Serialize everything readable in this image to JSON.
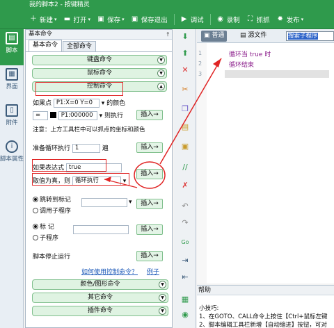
{
  "window": {
    "title": "我的脚本2 - 按键精灵"
  },
  "toolbar": {
    "items": [
      {
        "label": "新建",
        "icon": "new-icon"
      },
      {
        "label": "打开",
        "icon": "open-icon"
      },
      {
        "label": "保存",
        "icon": "save-icon"
      },
      {
        "label": "保存退出",
        "icon": "save-exit-icon"
      },
      {
        "label": "调试",
        "icon": "debug-icon"
      },
      {
        "label": "录制",
        "icon": "record-icon"
      },
      {
        "label": "抓抓",
        "icon": "capture-icon"
      },
      {
        "label": "发布",
        "icon": "publish-icon"
      }
    ]
  },
  "rail": {
    "items": [
      {
        "label": "脚本",
        "icon": "script-icon",
        "active": true
      },
      {
        "label": "界面",
        "icon": "ui-icon"
      },
      {
        "label": "附件",
        "icon": "attachment-icon"
      },
      {
        "label": "脚本属性",
        "icon": "info-icon"
      }
    ]
  },
  "panel": {
    "title": "基本命令",
    "pin": "⫯",
    "tabs": [
      "基本命令",
      "全部命令"
    ],
    "groups": {
      "keyboard": "键盘命令",
      "mouse": "鼠标命令",
      "control": "控制命令",
      "color": "颜色/图形命令",
      "other": "其它命令",
      "plugin": "插件命令"
    },
    "if_point": {
      "prefix": "如果点",
      "coords": "P1:X=0 Y=0",
      "suffix": "的颜色",
      "operator": "=",
      "color_value": "P1:000000",
      "then": "则执行",
      "insert": "插入→"
    },
    "note": "注意：上方工具栏中可以抓点的坐标和颜色",
    "loop": {
      "prefix": "准备循环执行",
      "count": "1",
      "suffix": "遍",
      "insert": "插入→"
    },
    "if_expr": {
      "prefix": "如果表达式",
      "value": "true",
      "cond_prefix": "取值为真，则",
      "cond_value": "循环执行",
      "insert": "插入→"
    },
    "jump": {
      "option1": "跳转到标记",
      "option2": "调用子程序",
      "insert": "插入→"
    },
    "label": {
      "option1": "标 记",
      "option2": "子程序",
      "insert": "插入→"
    },
    "stop": {
      "label": "脚本停止运行",
      "insert": "插入→"
    },
    "links": {
      "how": "如何使用控制命令？",
      "example": "例子"
    }
  },
  "editor": {
    "tabs": {
      "normal": "普通",
      "source": "源文件"
    },
    "search_text": "搜索子程序",
    "lines": [
      "循环当 true 时",
      "循环结束",
      ""
    ],
    "line_numbers": [
      "1",
      "2",
      "3"
    ]
  },
  "help": {
    "title": "帮助",
    "lines": [
      "小技巧:",
      "1、在GOTO、CALL命令上按住【Ctrl+鼠标左键",
      "2、脚本编辑工具栏新增【自动缩进】按钮，可对"
    ]
  },
  "colors": {
    "accent": "#2f9a4c",
    "annotation_red": "#e02424",
    "code_keyword": "#8a1b8a"
  }
}
